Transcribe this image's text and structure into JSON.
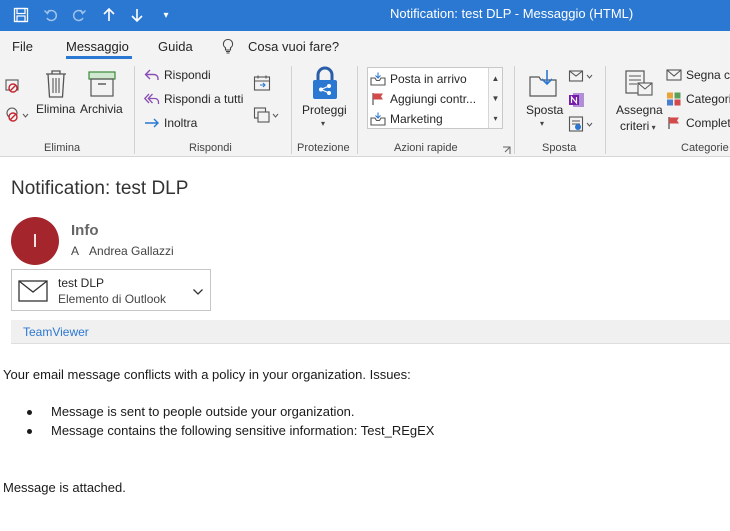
{
  "window": {
    "title": "Notification: test DLP  -  Messaggio (HTML)"
  },
  "quick_access": {
    "more_label": "▾"
  },
  "tabs": [
    {
      "label": "File"
    },
    {
      "label": "Messaggio",
      "active": true
    },
    {
      "label": "Guida"
    },
    {
      "label": "Cosa vuoi fare?"
    }
  ],
  "ribbon": {
    "groups": {
      "elimina": {
        "label": "Elimina",
        "delete_label": "Elimina",
        "archive_label": "Archivia"
      },
      "rispondi": {
        "label": "Rispondi",
        "reply_label": "Rispondi",
        "reply_all_label": "Rispondi a tutti",
        "forward_label": "Inoltra"
      },
      "protezione": {
        "label": "Protezione",
        "protect_label": "Proteggi"
      },
      "azioni_rapide": {
        "label": "Azioni rapide",
        "items": [
          "Posta in arrivo",
          "Aggiungi contr...",
          "Marketing"
        ]
      },
      "sposta": {
        "label": "Sposta",
        "move_label": "Sposta"
      },
      "categorie": {
        "label": "Categorie",
        "assign_label_1": "Assegna",
        "assign_label_2": "criteri",
        "mark_label": "Segna co",
        "categorize_label": "Categori",
        "complete_label": "Complet"
      }
    }
  },
  "message": {
    "subject": "Notification: test DLP",
    "avatar_initial": "I",
    "sender": "Info",
    "to_prefix": "A",
    "to_name": "Andrea Gallazzi",
    "attachment": {
      "name": "test DLP",
      "type": "Elemento di Outlook"
    },
    "addin": "TeamViewer",
    "body": {
      "intro": "Your email message conflicts with a policy in your organization. Issues:",
      "issues": [
        "Message is sent to people outside your organization.",
        "Message contains the following sensitive information: Test_REgEX"
      ],
      "footer": "Message is attached."
    }
  },
  "colors": {
    "accent": "#2b78d2",
    "avatar": "#a4262c"
  }
}
